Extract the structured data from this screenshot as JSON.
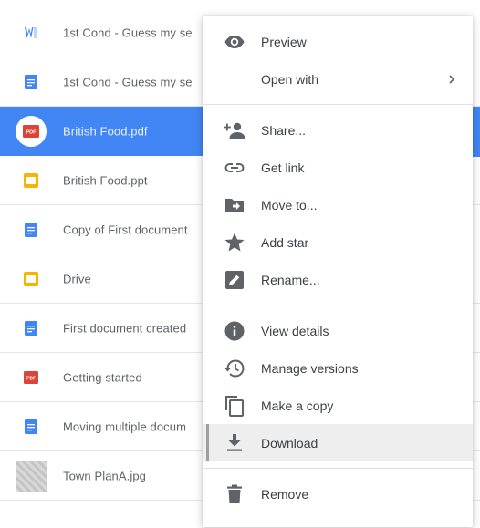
{
  "files": [
    {
      "name": "1st Cond - Guess my se",
      "type": "word"
    },
    {
      "name": "1st Cond - Guess my se",
      "type": "doc"
    },
    {
      "name": "British Food.pdf",
      "type": "pdf",
      "selected": true
    },
    {
      "name": "British Food.ppt",
      "type": "slides"
    },
    {
      "name": "Copy of First document",
      "type": "doc"
    },
    {
      "name": "Drive",
      "type": "slides"
    },
    {
      "name": "First document created",
      "type": "doc"
    },
    {
      "name": "Getting started",
      "type": "pdf"
    },
    {
      "name": "Moving multiple docum",
      "type": "doc"
    },
    {
      "name": "Town PlanA.jpg",
      "type": "image"
    }
  ],
  "menu": {
    "preview": "Preview",
    "open_with": "Open with",
    "share": "Share...",
    "get_link": "Get link",
    "move_to": "Move to...",
    "add_star": "Add star",
    "rename": "Rename...",
    "view_details": "View details",
    "manage_versions": "Manage versions",
    "make_copy": "Make a copy",
    "download": "Download",
    "remove": "Remove"
  },
  "colors": {
    "selection": "#4285f4",
    "doc_blue": "#4285f4",
    "slides_yellow": "#f4b400",
    "pdf_red": "#db4437",
    "icon_gray": "#5f6368"
  }
}
